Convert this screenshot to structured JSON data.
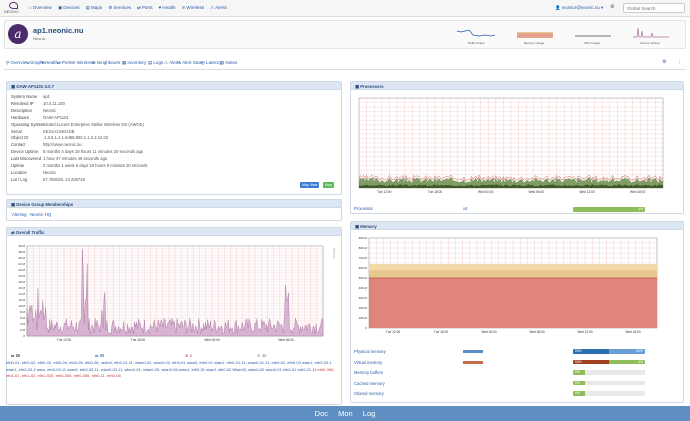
{
  "brand": "NEONIC",
  "nav": [
    {
      "icon": "⌂",
      "label": "Overview"
    },
    {
      "icon": "▣",
      "label": "Devices"
    },
    {
      "icon": "▤",
      "label": "Maps"
    },
    {
      "icon": "⚙",
      "label": "Services"
    },
    {
      "icon": "⇄",
      "label": "Ports"
    },
    {
      "icon": "♥",
      "label": "Health"
    },
    {
      "icon": "≋",
      "label": "Wireless"
    },
    {
      "icon": "⚠",
      "label": "Alerts"
    }
  ],
  "user": "monitor@neonic.nu",
  "search_placeholder": "Global Search",
  "device": {
    "name": "ap1.neonic.nu",
    "location": "Neonic",
    "minigraphs": [
      "Traffic Graph",
      "Memory Usage",
      "CPU Usage",
      "Device Uptime"
    ]
  },
  "tabs": [
    {
      "icon": "⚲",
      "label": "Overview"
    },
    {
      "icon": "∿",
      "label": "Graphs"
    },
    {
      "icon": "♥",
      "label": "Health"
    },
    {
      "icon": "⇄",
      "label": "Ports"
    },
    {
      "icon": "≋",
      "label": "Wireless"
    },
    {
      "icon": "⊕",
      "label": "Neighbours"
    },
    {
      "icon": "▦",
      "label": "Inventory"
    },
    {
      "icon": "▤",
      "label": "Logs"
    },
    {
      "icon": "⚠",
      "label": "Alerts"
    },
    {
      "icon": "⚠",
      "label": "Alert Stats"
    },
    {
      "icon": "◷",
      "label": "Latency"
    },
    {
      "icon": "▤",
      "label": "Notes"
    }
  ],
  "overview": {
    "title": "OAW-AP1101-3.0.7",
    "rows": [
      [
        "System Name",
        "ap1"
      ],
      [
        "Resolved IP",
        "10.0.11.100"
      ],
      [
        "Description",
        "Neonic"
      ],
      [
        "Hardware",
        "OAW-AP1101"
      ],
      [
        "Operating System",
        "Alcatel-Lucent Enterprise Stellar Wireless OS (AWOS)"
      ],
      [
        "Serial",
        "KE21A134O1DB"
      ],
      [
        "Object ID",
        ".1.3.6.1.4.1.6486.800.1.1.2.2.12.02"
      ],
      [
        "Contact",
        "http://www.neonic.nu"
      ],
      [
        "Device Uptime",
        "8 months 4 days 18 hours 11 minutes 20 seconds ago"
      ],
      [
        "Last Discovered",
        "1 hour 37 minutes 46 seconds ago"
      ],
      [
        "Uptime",
        "2 months 1 week 6 days 18 hours 9 minutes 20 seconds"
      ],
      [
        "Location",
        "Neonic"
      ],
      [
        "Lat / Lng",
        "57.768228, 14.235746"
      ]
    ],
    "btn_view": "Map View",
    "btn_map": "Map"
  },
  "groups": {
    "title": "Device Group Memberships",
    "items": [
      "Alerting",
      "Neonic HQ"
    ]
  },
  "traffic": {
    "title": "Overall Traffic",
    "ylabel": "bits/sec",
    "yticks": [
      "30 M",
      "28 M",
      "26 M",
      "24 M",
      "22 M",
      "20 M",
      "18 M",
      "16 M",
      "14 M",
      "12 M",
      "10 M",
      "8 M",
      "6 M",
      "4 M",
      "2 M",
      "0"
    ],
    "xticks": [
      "Tue 12:00",
      "Tue 18:00",
      "Wed 00:00",
      "Wed 06:00"
    ],
    "stats": [
      {
        "icon": "⇄",
        "value": "86"
      },
      {
        "icon": "⇄",
        "value": "86"
      },
      {
        "icon": "⊗",
        "value": "1"
      },
      {
        "icon": "⊘",
        "value": "42"
      }
    ],
    "ports_a": "eth0-01, eth0-02, eth0-03, eth0-04, eth0-05, eth0-06, radio0, eth0-01.11, wlan0-02, wlan0-03, eth0-01 wlan0, eth0-01 wlan1, eth0-01.11, wlan0-01.11, eth0-02, eth0-03 wlan1, eth0-03.1 wlan1, eth0-03.2 wlan, eth0-03.11 wlan0, eth0-03.11, wlan0-03.11, wlan0-01, wlan0-05, wlan0-06 wlan1, eth0-01 wlan1 eth0-02 Wlan05, wlan0-02 wlan0-01 eth0-01 eth0-01.11",
    "ports_b": "eth0-065, eth1-01, eth1-02, eth1-025, eth0-006, eth0-055, eth0-11, eth0-05"
  },
  "processors": {
    "title": "Processors",
    "xticks": [
      "Tue 12:00",
      "Tue 18:00",
      "Wed 00:00",
      "Wed 06:00",
      "Wed 12:00",
      "Wed 18:00"
    ],
    "row": {
      "label": "Processor",
      "count": "x4",
      "pct": 4
    }
  },
  "memory": {
    "title": "Memory",
    "yticks": [
      "900 M",
      "800 M",
      "700 M",
      "600 M",
      "500 M",
      "400 M",
      "300 M",
      "200 M",
      "100 M",
      "0"
    ],
    "xticks": [
      "Tue 12:00",
      "Tue 18:00",
      "Wed 00:00",
      "Wed 06:00",
      "Wed 12:00",
      "Wed 18:00"
    ],
    "rows": [
      {
        "label": "Physical memory",
        "left": "50%",
        "right": "50%",
        "pct": 50,
        "color": "#5b8fc4"
      },
      {
        "label": "Virtual memory",
        "left": "50%",
        "right": "0%",
        "pct": 50,
        "color": "#c46b4a"
      },
      {
        "label": "Memory buffers",
        "left": "0%",
        "right": "",
        "pct": 0,
        "color": "#8fbd5a"
      },
      {
        "label": "Cached memory",
        "left": "0%",
        "right": "",
        "pct": 0,
        "color": "#8fbd5a"
      },
      {
        "label": "Shared memory",
        "left": "0%",
        "right": "",
        "pct": 0,
        "color": "#8fbd5a"
      }
    ]
  },
  "footer": [
    "Doc",
    "Mon",
    "Log"
  ],
  "colors": {
    "header": "#dde7f3",
    "link": "#2a5aa8",
    "footer": "#5f8ec3",
    "traffic": "#b07aa8"
  }
}
